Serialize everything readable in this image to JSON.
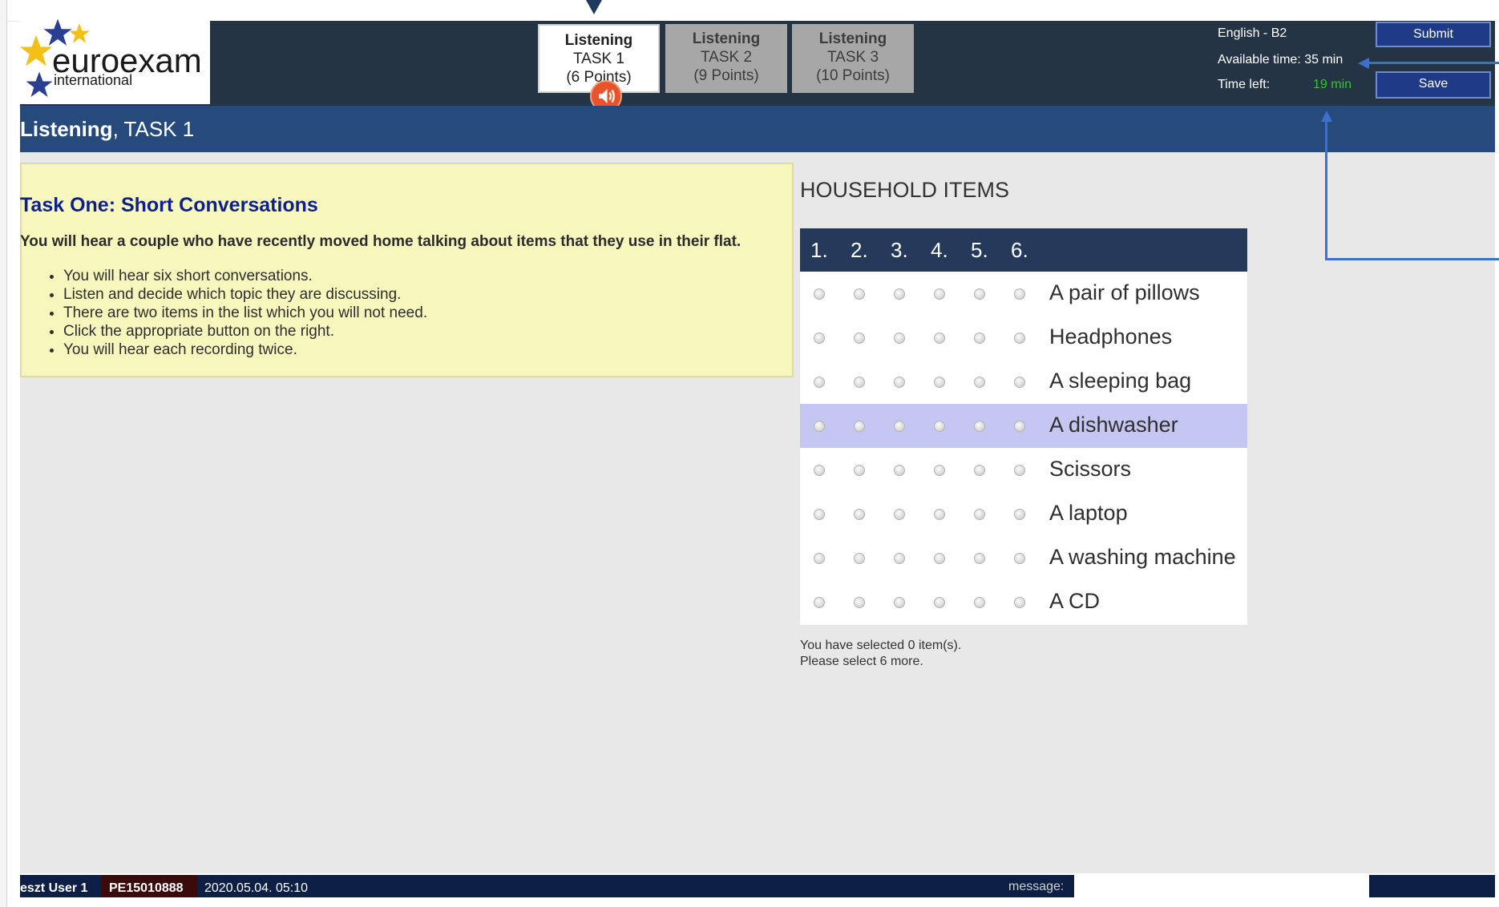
{
  "logo": {
    "brand": "euroexam",
    "sub": "international"
  },
  "tabs": [
    {
      "title": "Listening",
      "task": "TASK 1",
      "points": "(6 Points)"
    },
    {
      "title": "Listening",
      "task": "TASK 2",
      "points": "(9 Points)"
    },
    {
      "title": "Listening",
      "task": "TASK 3",
      "points": "(10 Points)"
    }
  ],
  "header": {
    "level": "English - B2",
    "available_time": "Available time: 35 min",
    "time_left_label": "Time left:",
    "time_left_value": "19 min",
    "submit_label": "Submit",
    "save_label": "Save"
  },
  "titlebar": {
    "bold": "Listening",
    "rest": ", TASK 1"
  },
  "instructions": {
    "heading": "Task One: Short Conversations",
    "intro": "You will hear a couple who have recently moved home talking about items that they use in their flat.",
    "bullets": [
      "You will hear six short conversations.",
      "Listen and decide which topic they are discussing.",
      "There are two items in the list which you will not need.",
      "Click the appropriate button on the right.",
      "You will hear each recording twice."
    ]
  },
  "items_section": {
    "title": "HOUSEHOLD ITEMS",
    "columns": [
      "1.",
      "2.",
      "3.",
      "4.",
      "5.",
      "6."
    ],
    "rows": [
      "A pair of pillows",
      "Headphones",
      "A sleeping bag",
      "A dishwasher",
      "Scissors",
      "A laptop",
      "A washing machine",
      "A CD"
    ],
    "highlighted_row": 3,
    "status_line1": "You have selected 0 item(s).",
    "status_line2": "Please select 6 more."
  },
  "footer": {
    "user": "eszt User 1",
    "id": "PE15010888",
    "datetime": "2020.05.04. 05:10",
    "message_label": "message:"
  },
  "colors": {
    "header_bg": "#253444",
    "titlebar_bg": "#264a7c",
    "instructions_bg": "#f7f6bd",
    "highlight_row": "#c6c6f3",
    "time_left": "#31c431",
    "heading_blue": "#0d1f8a"
  }
}
